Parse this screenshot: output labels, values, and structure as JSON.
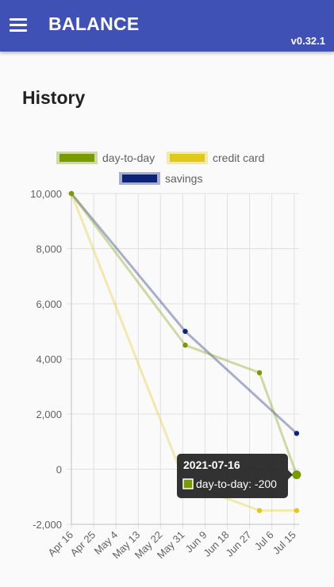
{
  "app": {
    "title": "BALANCE",
    "version": "v0.32.1"
  },
  "page": {
    "title": "History"
  },
  "tooltip": {
    "date": "2021-07-16",
    "series": "day-to-day",
    "value": "-200",
    "text": "day-to-day: -200"
  },
  "colors": {
    "appbar": "#3f51b5",
    "day_to_day": "#7a9a01",
    "credit_card": "#e0c91c",
    "savings": "#0d2278"
  },
  "chart_data": {
    "type": "line",
    "legend": [
      "day-to-day",
      "credit card",
      "savings"
    ],
    "legend_position": "top",
    "grid": true,
    "xlim": [
      "2021-04-16",
      "2021-07-17"
    ],
    "ylim": [
      -2000,
      10000
    ],
    "xticks": [
      "Apr 16",
      "Apr 25",
      "May 4",
      "May 13",
      "May 22",
      "May 31",
      "Jun 9",
      "Jun 18",
      "Jun 27",
      "Jul 6",
      "Jul 15"
    ],
    "yticks": [
      "10,000",
      "8,000",
      "6,000",
      "4,000",
      "2,000",
      "0",
      "-2,000"
    ],
    "series": [
      {
        "name": "day-to-day",
        "color": "#7a9a01",
        "points": [
          {
            "x": "2021-04-16",
            "y": 10000
          },
          {
            "x": "2021-06-01",
            "y": 4500
          },
          {
            "x": "2021-07-01",
            "y": 3500
          },
          {
            "x": "2021-07-16",
            "y": -200
          }
        ]
      },
      {
        "name": "credit card",
        "color": "#e0c91c",
        "points": [
          {
            "x": "2021-04-16",
            "y": 10000
          },
          {
            "x": "2021-06-01",
            "y": -500
          },
          {
            "x": "2021-07-01",
            "y": -1500
          },
          {
            "x": "2021-07-16",
            "y": -1500
          }
        ]
      },
      {
        "name": "savings",
        "color": "#0d2278",
        "points": [
          {
            "x": "2021-04-16",
            "y": 10000
          },
          {
            "x": "2021-06-01",
            "y": 5000
          },
          {
            "x": "2021-07-16",
            "y": 1300
          }
        ]
      }
    ]
  }
}
